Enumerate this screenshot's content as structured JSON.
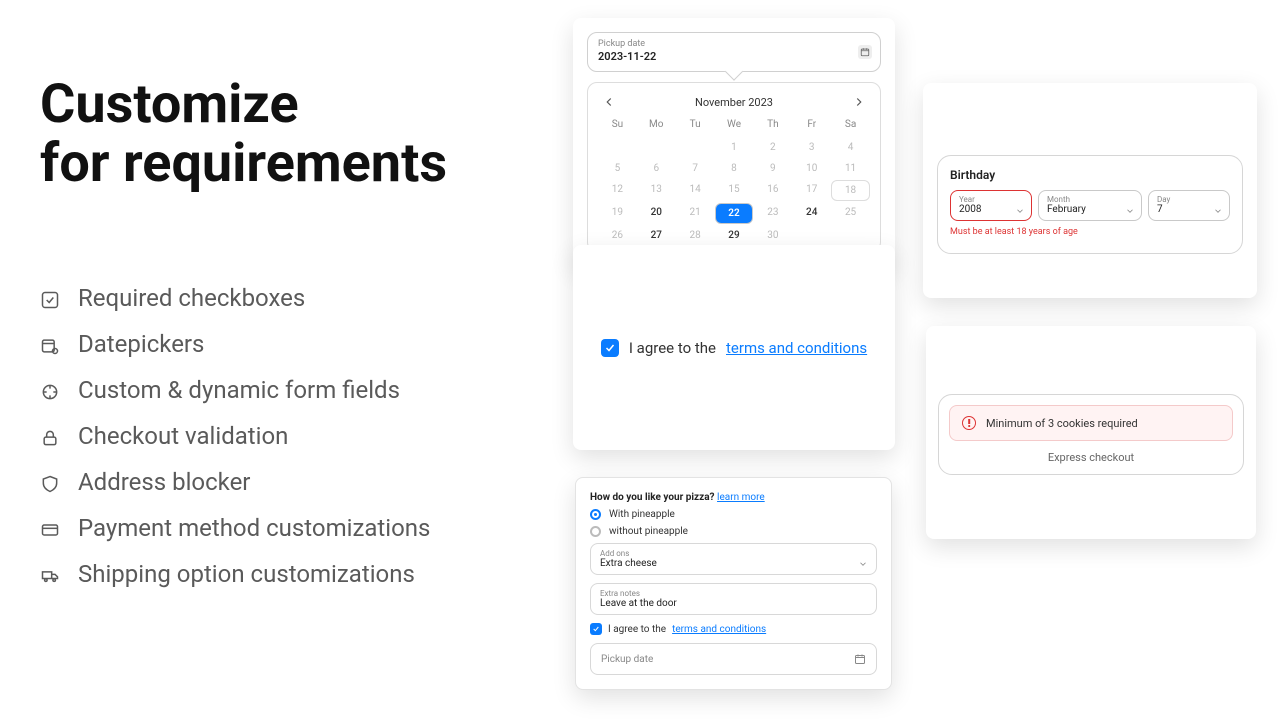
{
  "heading_line1": "Customize",
  "heading_line2": "for requirements",
  "features": [
    "Required checkboxes",
    "Datepickers",
    "Custom & dynamic form fields",
    "Checkout validation",
    "Address blocker",
    "Payment method customizations",
    "Shipping option customizations"
  ],
  "calendar": {
    "label": "Pickup date",
    "value": "2023-11-22",
    "month_title": "November 2023",
    "dow": [
      "Su",
      "Mo",
      "Tu",
      "We",
      "Th",
      "Fr",
      "Sa"
    ],
    "days": [
      {
        "n": "",
        "en": false
      },
      {
        "n": "",
        "en": false
      },
      {
        "n": "",
        "en": false
      },
      {
        "n": "1",
        "en": false
      },
      {
        "n": "2",
        "en": false
      },
      {
        "n": "3",
        "en": false
      },
      {
        "n": "4",
        "en": false
      },
      {
        "n": "5",
        "en": false
      },
      {
        "n": "6",
        "en": false
      },
      {
        "n": "7",
        "en": false
      },
      {
        "n": "8",
        "en": false
      },
      {
        "n": "9",
        "en": false
      },
      {
        "n": "10",
        "en": false
      },
      {
        "n": "11",
        "en": false
      },
      {
        "n": "12",
        "en": false
      },
      {
        "n": "13",
        "en": false
      },
      {
        "n": "14",
        "en": false
      },
      {
        "n": "15",
        "en": false
      },
      {
        "n": "16",
        "en": false
      },
      {
        "n": "17",
        "en": false
      },
      {
        "n": "18",
        "en": false,
        "today": true
      },
      {
        "n": "19",
        "en": false
      },
      {
        "n": "20",
        "en": true
      },
      {
        "n": "21",
        "en": false
      },
      {
        "n": "22",
        "en": true,
        "sel": true
      },
      {
        "n": "23",
        "en": false
      },
      {
        "n": "24",
        "en": true
      },
      {
        "n": "25",
        "en": false
      },
      {
        "n": "26",
        "en": false
      },
      {
        "n": "27",
        "en": true
      },
      {
        "n": "28",
        "en": false
      },
      {
        "n": "29",
        "en": true
      },
      {
        "n": "30",
        "en": false
      },
      {
        "n": "",
        "en": false
      },
      {
        "n": "",
        "en": false
      }
    ]
  },
  "terms": {
    "text": "I agree to the ",
    "link": "terms and conditions"
  },
  "pizza": {
    "question": "How do you like your pizza? ",
    "learn_link": "learn more",
    "opt1": "With pineapple",
    "opt2": "without pineapple",
    "addons_label": "Add ons",
    "addons_value": "Extra cheese",
    "notes_label": "Extra notes",
    "notes_value": "Leave at the door",
    "terms_text": "I agree to the ",
    "terms_link": "terms and conditions",
    "pickup_placeholder": "Pickup date"
  },
  "birthday": {
    "title": "Birthday",
    "year_label": "Year",
    "year_value": "2008",
    "month_label": "Month",
    "month_value": "February",
    "day_label": "Day",
    "day_value": "7",
    "error": "Must be at least 18 years of age"
  },
  "validation": {
    "alert_text": "Minimum of 3 cookies required",
    "express": "Express checkout"
  }
}
